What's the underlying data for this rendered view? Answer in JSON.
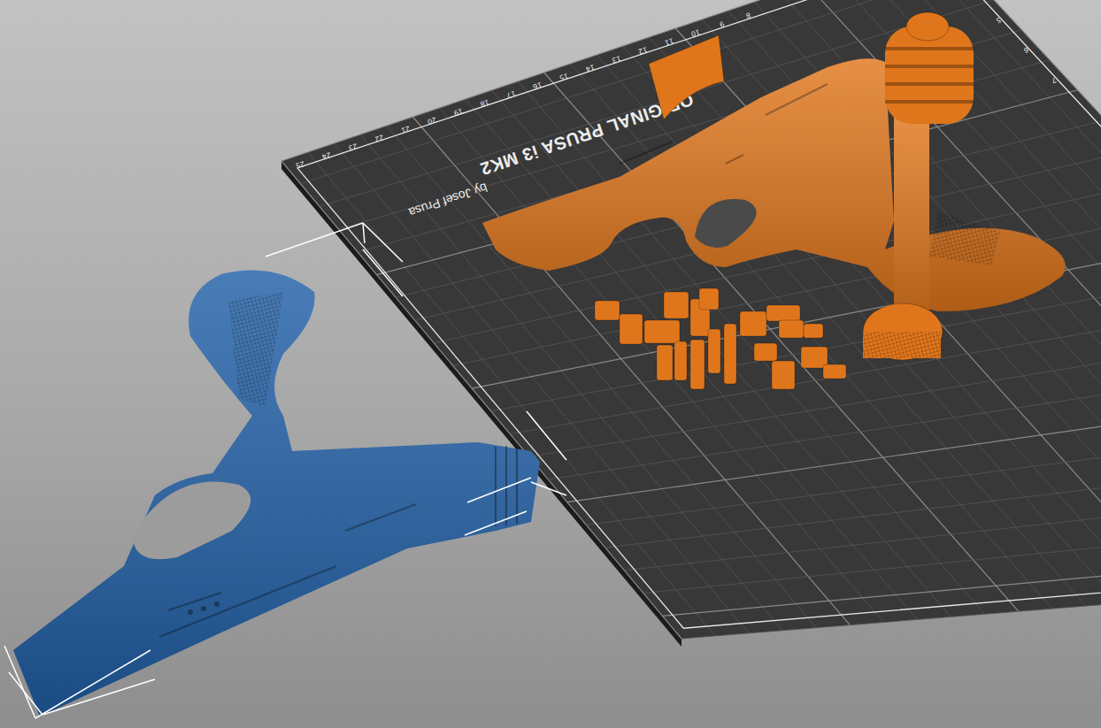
{
  "bed": {
    "title": "ORIGINAL PRUSA i3 MK2",
    "subtitle": "by Josef Prusa",
    "ruler_top": [
      "25",
      "24",
      "23",
      "22",
      "21",
      "20",
      "19",
      "18",
      "17",
      "16",
      "15",
      "14",
      "13",
      "12",
      "11",
      "10",
      "9",
      "8"
    ],
    "ruler_right": [
      "5",
      "6",
      "7"
    ]
  },
  "objects": [
    {
      "kind": "frame",
      "outside_bed": false,
      "color": "#e0761c"
    },
    {
      "kind": "cap",
      "outside_bed": false,
      "color": "#e0761c"
    },
    {
      "kind": "barrel",
      "outside_bed": false,
      "color": "#e0761c"
    },
    {
      "kind": "small-parts",
      "outside_bed": false,
      "color": "#e0761c"
    },
    {
      "kind": "blaster",
      "outside_bed": true,
      "color": "#2160a8"
    }
  ]
}
